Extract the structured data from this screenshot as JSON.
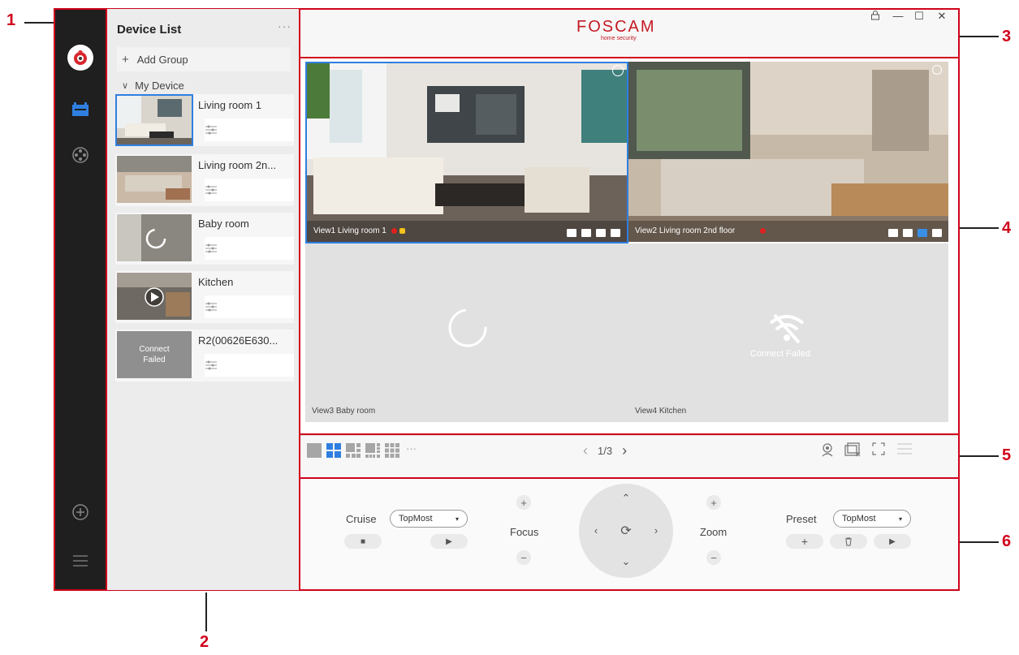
{
  "callouts": [
    "1",
    "2",
    "3",
    "4",
    "5",
    "6"
  ],
  "app": {
    "brand": "FOSCAM",
    "brand_sub": "home security",
    "window_controls": {
      "lock": "lock-icon",
      "minimize": "—",
      "maximize": "☐",
      "close": "✕"
    }
  },
  "sidebar": {
    "icons": [
      "foscam-logo",
      "live-view-icon",
      "playback-icon",
      "add-device-icon",
      "menu-icon"
    ]
  },
  "device_list": {
    "title": "Device List",
    "more": "···",
    "add_group": "Add Group",
    "my_device": "My Device",
    "devices": [
      {
        "name": "Living room 1"
      },
      {
        "name": "Living room 2n..."
      },
      {
        "name": "Baby room"
      },
      {
        "name": "Kitchen"
      },
      {
        "name": "R2(00626E630...",
        "status": "Connect Failed"
      }
    ]
  },
  "views": [
    {
      "label": "View1 Living room 1"
    },
    {
      "label": "View2 Living room 2nd floor"
    },
    {
      "label": "View3 Baby room"
    },
    {
      "label": "View4  Kitchen",
      "status": "Connect Failed"
    }
  ],
  "layout_bar": {
    "more": "···",
    "page": "1/3",
    "prev": "‹",
    "next": "›"
  },
  "ptz": {
    "cruise_label": "Cruise",
    "cruise_value": "TopMost",
    "focus_label": "Focus",
    "zoom_label": "Zoom",
    "preset_label": "Preset",
    "preset_value": "TopMost",
    "plus": "+",
    "minus": "−",
    "stop": "■",
    "play": "▶",
    "trash": "🗑"
  },
  "colors": {
    "brand_red": "#c41a23",
    "callout_red": "#d0021b",
    "sidebar_bg": "#1f1f1f",
    "selected_blue": "#2f7fe0"
  }
}
